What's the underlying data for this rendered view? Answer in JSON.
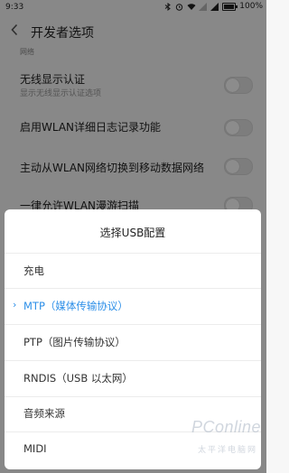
{
  "status_bar": {
    "time": "9:33",
    "battery_text": "100%",
    "battery_level": 1.0,
    "icons": [
      "bluetooth-icon",
      "alarm-icon",
      "wifi-icon",
      "signal-icon",
      "signal-icon",
      "battery-icon"
    ]
  },
  "header": {
    "title": "开发者选项",
    "back_icon": "chevron-left-icon"
  },
  "settings": {
    "partial_label": "网络",
    "rows": [
      {
        "title": "无线显示认证",
        "subtitle": "显示无线显示认证选项",
        "toggle_on": false
      },
      {
        "title": "启用WLAN详细日志记录功能",
        "toggle_on": false
      },
      {
        "title": "主动从WLAN网络切换到移动数据网络",
        "toggle_on": false
      },
      {
        "title": "一律允许WLAN漫游扫描",
        "toggle_on": false
      }
    ]
  },
  "dialog": {
    "title": "选择USB配置",
    "selected_index": 1,
    "options": [
      "充电",
      "MTP（媒体传输协议）",
      "PTP（图片传输协议）",
      "RNDIS（USB 以太网）",
      "音频来源",
      "MIDI"
    ]
  },
  "watermark": {
    "brand": "PConline",
    "subtitle": "太平洋电脑网"
  },
  "colors": {
    "accent": "#2d8fe8",
    "overlay": "rgba(0,0,0,0.45)"
  }
}
